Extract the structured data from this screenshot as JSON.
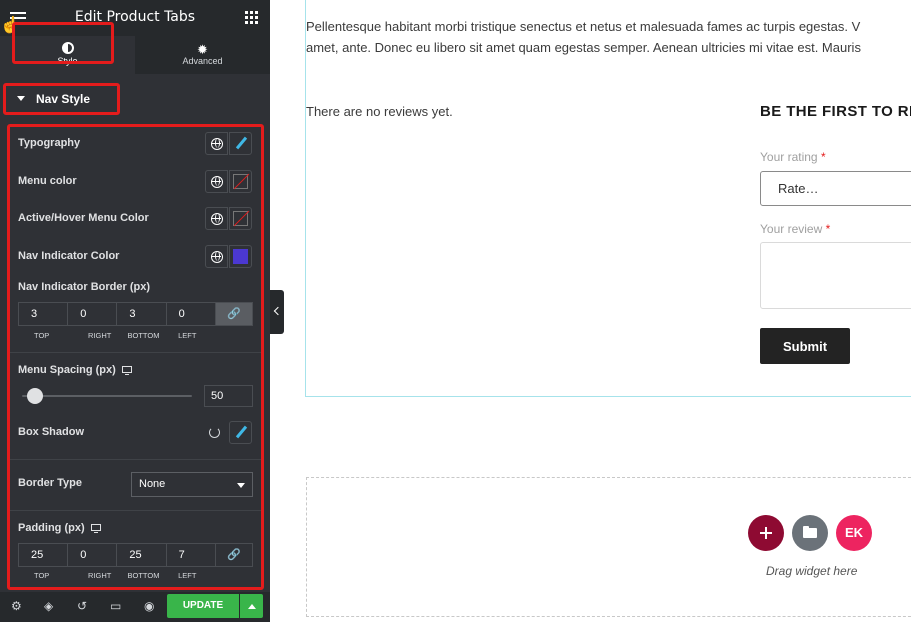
{
  "panel": {
    "title": "Edit Product Tabs",
    "tabs": [
      {
        "label": "Style",
        "icon": "contrast-icon",
        "active": true
      },
      {
        "label": "Advanced",
        "icon": "gear-icon",
        "active": false
      }
    ],
    "section": {
      "title": "Nav Style",
      "expanded": true
    },
    "controls": {
      "typography": {
        "label": "Typography"
      },
      "menu_color": {
        "label": "Menu color",
        "value": ""
      },
      "active_hover_color": {
        "label": "Active/Hover Menu Color",
        "value": ""
      },
      "nav_indicator_color": {
        "label": "Nav Indicator Color",
        "value": "#4b38d1"
      },
      "nav_indicator_border": {
        "label": "Nav Indicator Border (px)",
        "top": "3",
        "right": "0",
        "bottom": "3",
        "left": "0",
        "labels": {
          "top": "TOP",
          "right": "RIGHT",
          "bottom": "BOTTOM",
          "left": "LEFT"
        },
        "linked": true
      },
      "menu_spacing": {
        "label": "Menu Spacing (px)",
        "value": "50",
        "slider_min": 0,
        "slider_max": 1000,
        "slider_value": 50
      },
      "box_shadow": {
        "label": "Box Shadow"
      },
      "border_type": {
        "label": "Border Type",
        "value": "None"
      },
      "padding": {
        "label": "Padding (px)",
        "top": "25",
        "right": "0",
        "bottom": "25",
        "left": "7",
        "labels": {
          "top": "TOP",
          "right": "RIGHT",
          "bottom": "BOTTOM",
          "left": "LEFT"
        },
        "linked": false
      }
    },
    "footer": {
      "update_label": "UPDATE"
    },
    "colors": {
      "accent_green": "#39b54a",
      "highlight_red": "#e41c1c",
      "panel_bg": "#2f3136"
    }
  },
  "preview": {
    "paragraph_line1": "Pellentesque habitant morbi tristique senectus et netus et malesuada fames ac turpis egestas. V",
    "paragraph_line2": "amet, ante. Donec eu libero sit amet quam egestas semper. Aenean ultricies mi vitae est. Mauris",
    "no_reviews": "There are no reviews yet.",
    "form_title": "BE THE FIRST TO RE",
    "rating_label": "Your rating",
    "rating_placeholder": "Rate…",
    "review_label": "Your review",
    "required_mark": "*",
    "submit_label": "Submit",
    "drag_hint": "Drag widget here",
    "ek_label": "EK"
  }
}
